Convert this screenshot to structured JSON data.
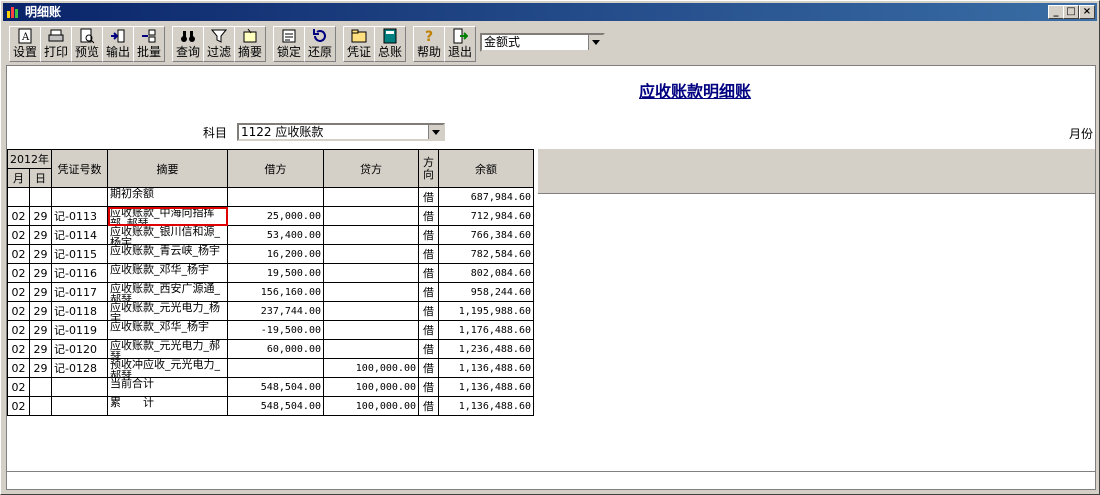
{
  "window": {
    "title": "明细账"
  },
  "toolbar": {
    "buttons": [
      {
        "label": "设置",
        "icon": "settings-icon"
      },
      {
        "label": "打印",
        "icon": "printer-icon"
      },
      {
        "label": "预览",
        "icon": "preview-icon"
      },
      {
        "label": "输出",
        "icon": "export-icon"
      },
      {
        "label": "批量",
        "icon": "batch-icon"
      },
      {
        "label": "查询",
        "icon": "binoculars-icon"
      },
      {
        "label": "过滤",
        "icon": "filter-icon"
      },
      {
        "label": "摘要",
        "icon": "summary-icon"
      },
      {
        "label": "锁定",
        "icon": "lock-icon"
      },
      {
        "label": "还原",
        "icon": "restore-icon"
      },
      {
        "label": "凭证",
        "icon": "voucher-icon"
      },
      {
        "label": "总账",
        "icon": "ledger-icon"
      },
      {
        "label": "帮助",
        "icon": "help-icon"
      },
      {
        "label": "退出",
        "icon": "exit-icon"
      }
    ],
    "format_select": "金额式"
  },
  "report": {
    "title": "应收账款明细账",
    "subject_label": "科目",
    "subject_value": "1122 应收账款",
    "period_label": "月份"
  },
  "table": {
    "year_header": "2012年",
    "month_header": "月",
    "day_header": "日",
    "voucher_header": "凭证号数",
    "memo_header": "摘要",
    "debit_header": "借方",
    "credit_header": "贷方",
    "direction_header": "方向",
    "balance_header": "余额",
    "rows": [
      {
        "m": "",
        "d": "",
        "v": "",
        "memo": "期初余额",
        "debit": "",
        "credit": "",
        "dir": "借",
        "bal": "687,984.60"
      },
      {
        "m": "02",
        "d": "29",
        "v": "记-0113",
        "memo": "应收账款_中海向指挥部_郝瑟",
        "debit": "25,000.00",
        "credit": "",
        "dir": "借",
        "bal": "712,984.60"
      },
      {
        "m": "02",
        "d": "29",
        "v": "记-0114",
        "memo": "应收账款_银川信和源_杨宇",
        "debit": "53,400.00",
        "credit": "",
        "dir": "借",
        "bal": "766,384.60"
      },
      {
        "m": "02",
        "d": "29",
        "v": "记-0115",
        "memo": "应收账款_青云峡_杨宇",
        "debit": "16,200.00",
        "credit": "",
        "dir": "借",
        "bal": "782,584.60"
      },
      {
        "m": "02",
        "d": "29",
        "v": "记-0116",
        "memo": "应收账款_邓华_杨宇",
        "debit": "19,500.00",
        "credit": "",
        "dir": "借",
        "bal": "802,084.60"
      },
      {
        "m": "02",
        "d": "29",
        "v": "记-0117",
        "memo": "应收账款_西安广源通_郝瑟",
        "debit": "156,160.00",
        "credit": "",
        "dir": "借",
        "bal": "958,244.60"
      },
      {
        "m": "02",
        "d": "29",
        "v": "记-0118",
        "memo": "应收账款_元光电力_杨宇",
        "debit": "237,744.00",
        "credit": "",
        "dir": "借",
        "bal": "1,195,988.60"
      },
      {
        "m": "02",
        "d": "29",
        "v": "记-0119",
        "memo": "应收账款_邓华_杨宇",
        "debit": "-19,500.00",
        "credit": "",
        "dir": "借",
        "bal": "1,176,488.60"
      },
      {
        "m": "02",
        "d": "29",
        "v": "记-0120",
        "memo": "应收账款_元光电力_郝瑟",
        "debit": "60,000.00",
        "credit": "",
        "dir": "借",
        "bal": "1,236,488.60"
      },
      {
        "m": "02",
        "d": "29",
        "v": "记-0128",
        "memo": "预收冲应收_元光电力_郝瑟",
        "debit": "",
        "credit": "100,000.00",
        "dir": "借",
        "bal": "1,136,488.60"
      },
      {
        "m": "02",
        "d": "",
        "v": "",
        "memo": "当前合计",
        "debit": "548,504.00",
        "credit": "100,000.00",
        "dir": "借",
        "bal": "1,136,488.60"
      },
      {
        "m": "02",
        "d": "",
        "v": "",
        "memo": "累　　计",
        "debit": "548,504.00",
        "credit": "100,000.00",
        "dir": "借",
        "bal": "1,136,488.60"
      }
    ]
  }
}
